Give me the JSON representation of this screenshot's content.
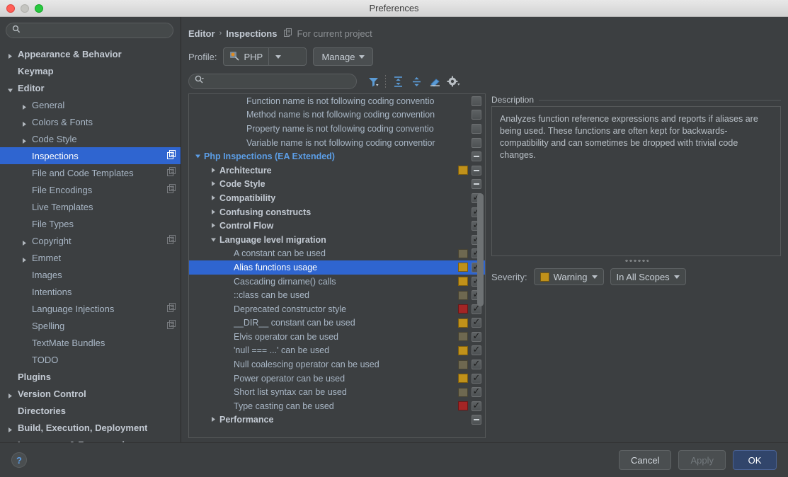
{
  "window": {
    "title": "Preferences"
  },
  "sidebar": {
    "search_placeholder": "",
    "search_value": "",
    "items": [
      {
        "label": "Appearance & Behavior",
        "level": 0,
        "arrow": "collapsed",
        "bold": true,
        "badge": false,
        "selected": false
      },
      {
        "label": "Keymap",
        "level": 0,
        "arrow": "none",
        "bold": true,
        "badge": false,
        "selected": false
      },
      {
        "label": "Editor",
        "level": 0,
        "arrow": "expanded",
        "bold": true,
        "badge": false,
        "selected": false
      },
      {
        "label": "General",
        "level": 1,
        "arrow": "collapsed",
        "bold": false,
        "badge": false,
        "selected": false
      },
      {
        "label": "Colors & Fonts",
        "level": 1,
        "arrow": "collapsed",
        "bold": false,
        "badge": false,
        "selected": false
      },
      {
        "label": "Code Style",
        "level": 1,
        "arrow": "collapsed",
        "bold": false,
        "badge": false,
        "selected": false
      },
      {
        "label": "Inspections",
        "level": 1,
        "arrow": "none",
        "bold": false,
        "badge": true,
        "selected": true
      },
      {
        "label": "File and Code Templates",
        "level": 1,
        "arrow": "none",
        "bold": false,
        "badge": true,
        "selected": false
      },
      {
        "label": "File Encodings",
        "level": 1,
        "arrow": "none",
        "bold": false,
        "badge": true,
        "selected": false
      },
      {
        "label": "Live Templates",
        "level": 1,
        "arrow": "none",
        "bold": false,
        "badge": false,
        "selected": false
      },
      {
        "label": "File Types",
        "level": 1,
        "arrow": "none",
        "bold": false,
        "badge": false,
        "selected": false
      },
      {
        "label": "Copyright",
        "level": 1,
        "arrow": "collapsed",
        "bold": false,
        "badge": true,
        "selected": false
      },
      {
        "label": "Emmet",
        "level": 1,
        "arrow": "collapsed",
        "bold": false,
        "badge": false,
        "selected": false
      },
      {
        "label": "Images",
        "level": 1,
        "arrow": "none",
        "bold": false,
        "badge": false,
        "selected": false
      },
      {
        "label": "Intentions",
        "level": 1,
        "arrow": "none",
        "bold": false,
        "badge": false,
        "selected": false
      },
      {
        "label": "Language Injections",
        "level": 1,
        "arrow": "none",
        "bold": false,
        "badge": true,
        "selected": false
      },
      {
        "label": "Spelling",
        "level": 1,
        "arrow": "none",
        "bold": false,
        "badge": true,
        "selected": false
      },
      {
        "label": "TextMate Bundles",
        "level": 1,
        "arrow": "none",
        "bold": false,
        "badge": false,
        "selected": false
      },
      {
        "label": "TODO",
        "level": 1,
        "arrow": "none",
        "bold": false,
        "badge": false,
        "selected": false
      },
      {
        "label": "Plugins",
        "level": 0,
        "arrow": "none",
        "bold": true,
        "badge": false,
        "selected": false
      },
      {
        "label": "Version Control",
        "level": 0,
        "arrow": "collapsed",
        "bold": true,
        "badge": false,
        "selected": false
      },
      {
        "label": "Directories",
        "level": 0,
        "arrow": "none",
        "bold": true,
        "badge": false,
        "selected": false
      },
      {
        "label": "Build, Execution, Deployment",
        "level": 0,
        "arrow": "collapsed",
        "bold": true,
        "badge": false,
        "selected": false
      },
      {
        "label": "Languages & Frameworks",
        "level": 0,
        "arrow": "collapsed",
        "bold": true,
        "badge": false,
        "selected": false
      }
    ]
  },
  "breadcrumb": {
    "parent": "Editor",
    "separator": "›",
    "current": "Inspections",
    "note": "For current project"
  },
  "profile": {
    "label": "Profile:",
    "value": "PHP",
    "manage_label": "Manage"
  },
  "toolbar": {
    "filter_placeholder": "",
    "filter_value": "",
    "icons": [
      {
        "name": "filter-icon"
      },
      {
        "name": "expand-all-icon"
      },
      {
        "name": "collapse-all-icon"
      },
      {
        "name": "reset-icon"
      },
      {
        "name": "gear-icon"
      }
    ]
  },
  "inspections": {
    "rows": [
      {
        "label": "Function name is not following coding conventio",
        "indent": 3,
        "arrow": "none",
        "style": "plain",
        "severity": null,
        "check": "empty",
        "selected": false
      },
      {
        "label": "Method name is not following coding convention",
        "indent": 3,
        "arrow": "none",
        "style": "plain",
        "severity": null,
        "check": "empty",
        "selected": false
      },
      {
        "label": "Property name is not following coding conventio",
        "indent": 3,
        "arrow": "none",
        "style": "plain",
        "severity": null,
        "check": "empty",
        "selected": false
      },
      {
        "label": "Variable name is not following coding conventior",
        "indent": 3,
        "arrow": "none",
        "style": "plain",
        "severity": null,
        "check": "empty",
        "selected": false
      },
      {
        "label": "Php Inspections (EA Extended)",
        "indent": 0,
        "arrow": "expanded",
        "style": "root",
        "severity": null,
        "check": "dash",
        "selected": false
      },
      {
        "label": "Architecture",
        "indent": 1,
        "arrow": "collapsed",
        "style": "group",
        "severity": "#c0911a",
        "check": "dash",
        "selected": false
      },
      {
        "label": "Code Style",
        "indent": 1,
        "arrow": "collapsed",
        "style": "group",
        "severity": null,
        "check": "dash",
        "selected": false
      },
      {
        "label": "Compatibility",
        "indent": 1,
        "arrow": "collapsed",
        "style": "group",
        "severity": null,
        "check": "check",
        "selected": false
      },
      {
        "label": "Confusing constructs",
        "indent": 1,
        "arrow": "collapsed",
        "style": "group",
        "severity": null,
        "check": "check",
        "selected": false
      },
      {
        "label": "Control Flow",
        "indent": 1,
        "arrow": "collapsed",
        "style": "group",
        "severity": null,
        "check": "check",
        "selected": false
      },
      {
        "label": "Language level migration",
        "indent": 1,
        "arrow": "expanded",
        "style": "group",
        "severity": null,
        "check": "check",
        "selected": false
      },
      {
        "label": "A constant can be used",
        "indent": 2,
        "arrow": "none",
        "style": "plain",
        "severity": "#6e6850",
        "check": "check",
        "selected": false
      },
      {
        "label": "Alias functions usage",
        "indent": 2,
        "arrow": "none",
        "style": "plain",
        "severity": "#c0911a",
        "check": "check",
        "selected": true
      },
      {
        "label": "Cascading dirname() calls",
        "indent": 2,
        "arrow": "none",
        "style": "plain",
        "severity": "#c0911a",
        "check": "check",
        "selected": false
      },
      {
        "label": "::class can be used",
        "indent": 2,
        "arrow": "none",
        "style": "plain",
        "severity": "#6e6850",
        "check": "check",
        "selected": false
      },
      {
        "label": "Deprecated constructor style",
        "indent": 2,
        "arrow": "none",
        "style": "plain",
        "severity": "#a32525",
        "check": "check",
        "selected": false
      },
      {
        "label": "__DIR__ constant can be used",
        "indent": 2,
        "arrow": "none",
        "style": "plain",
        "severity": "#c0911a",
        "check": "check",
        "selected": false
      },
      {
        "label": "Elvis operator can be used",
        "indent": 2,
        "arrow": "none",
        "style": "plain",
        "severity": "#6e6850",
        "check": "check",
        "selected": false
      },
      {
        "label": "'null === ...' can be used",
        "indent": 2,
        "arrow": "none",
        "style": "plain",
        "severity": "#c0911a",
        "check": "check",
        "selected": false
      },
      {
        "label": "Null coalescing operator can be used",
        "indent": 2,
        "arrow": "none",
        "style": "plain",
        "severity": "#6e6850",
        "check": "check",
        "selected": false
      },
      {
        "label": "Power operator can be used",
        "indent": 2,
        "arrow": "none",
        "style": "plain",
        "severity": "#c0911a",
        "check": "check",
        "selected": false
      },
      {
        "label": "Short list syntax can be used",
        "indent": 2,
        "arrow": "none",
        "style": "plain",
        "severity": "#6e6850",
        "check": "check",
        "selected": false
      },
      {
        "label": "Type casting can be used",
        "indent": 2,
        "arrow": "none",
        "style": "plain",
        "severity": "#a32525",
        "check": "check",
        "selected": false
      },
      {
        "label": "Performance",
        "indent": 1,
        "arrow": "collapsed",
        "style": "group",
        "severity": null,
        "check": "dash",
        "selected": false
      }
    ]
  },
  "description": {
    "legend": "Description",
    "text": "Analyzes function reference expressions and reports if aliases are being used. These functions are often kept for backwards-compatibility and can sometimes be dropped with trivial code changes."
  },
  "severity": {
    "label": "Severity:",
    "value": "Warning",
    "color": "#c0911a",
    "scope_value": "In All Scopes"
  },
  "footer": {
    "help_label": "?",
    "cancel_label": "Cancel",
    "apply_label": "Apply",
    "ok_label": "OK"
  }
}
